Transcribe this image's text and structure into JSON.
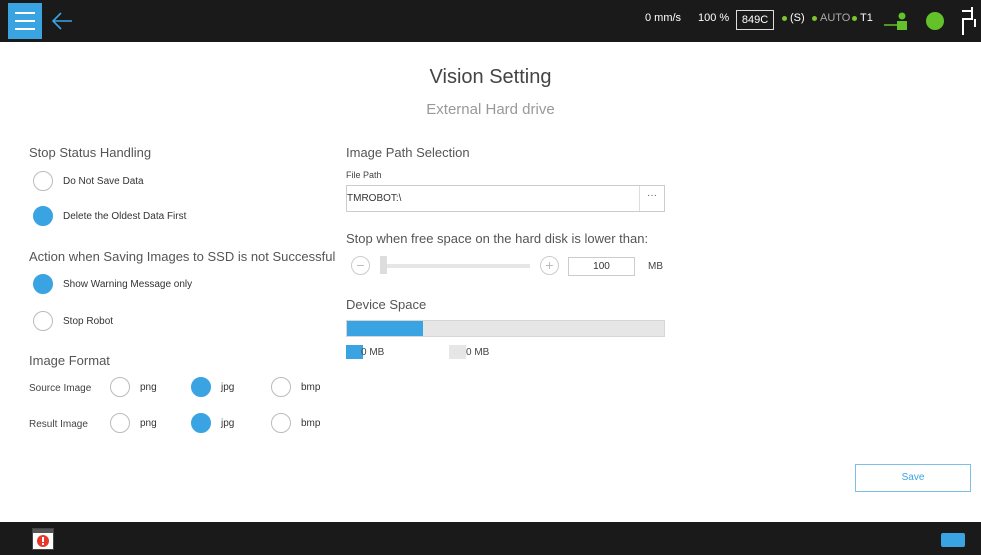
{
  "topbar": {
    "speed": "0 mm/s",
    "percent": "100 %",
    "code": "849C",
    "mode_symbol": "(S)",
    "auto_label": "AUTO",
    "t1_label": "T1"
  },
  "page": {
    "title": "Vision Setting",
    "subtitle": "External Hard drive"
  },
  "stop_status": {
    "heading": "Stop Status Handling",
    "options": [
      {
        "label": "Do Not Save Data",
        "selected": false
      },
      {
        "label": "Delete the Oldest Data First",
        "selected": true
      }
    ]
  },
  "ssd_action": {
    "heading": "Action when Saving Images to SSD is not Successful",
    "options": [
      {
        "label": "Show Warning Message only",
        "selected": true
      },
      {
        "label": "Stop Robot",
        "selected": false
      }
    ]
  },
  "image_format": {
    "heading": "Image Format",
    "rows": [
      {
        "label": "Source Image",
        "options": [
          "png",
          "jpg",
          "bmp"
        ],
        "selected": "jpg"
      },
      {
        "label": "Result Image",
        "options": [
          "png",
          "jpg",
          "bmp"
        ],
        "selected": "jpg"
      }
    ]
  },
  "image_path": {
    "heading": "Image Path Selection",
    "file_path_label": "File Path",
    "file_path_value": "TMROBOT:\\",
    "browse_label": "···"
  },
  "free_space": {
    "label": "Stop when free space on the hard disk is lower than:",
    "value": "100",
    "unit": "MB",
    "minus_symbol": "−",
    "plus_symbol": "+"
  },
  "device_space": {
    "heading": "Device Space",
    "used_fraction": 0.24,
    "used_label": "0 MB",
    "free_label": "0 MB",
    "used_color": "#3aa4e2",
    "free_color": "#e6e6e6"
  },
  "actions": {
    "save_label": "Save"
  },
  "colors": {
    "accent": "#3aa4e2",
    "status_green": "#63c22a",
    "bar_dark": "#1a1a1a"
  }
}
